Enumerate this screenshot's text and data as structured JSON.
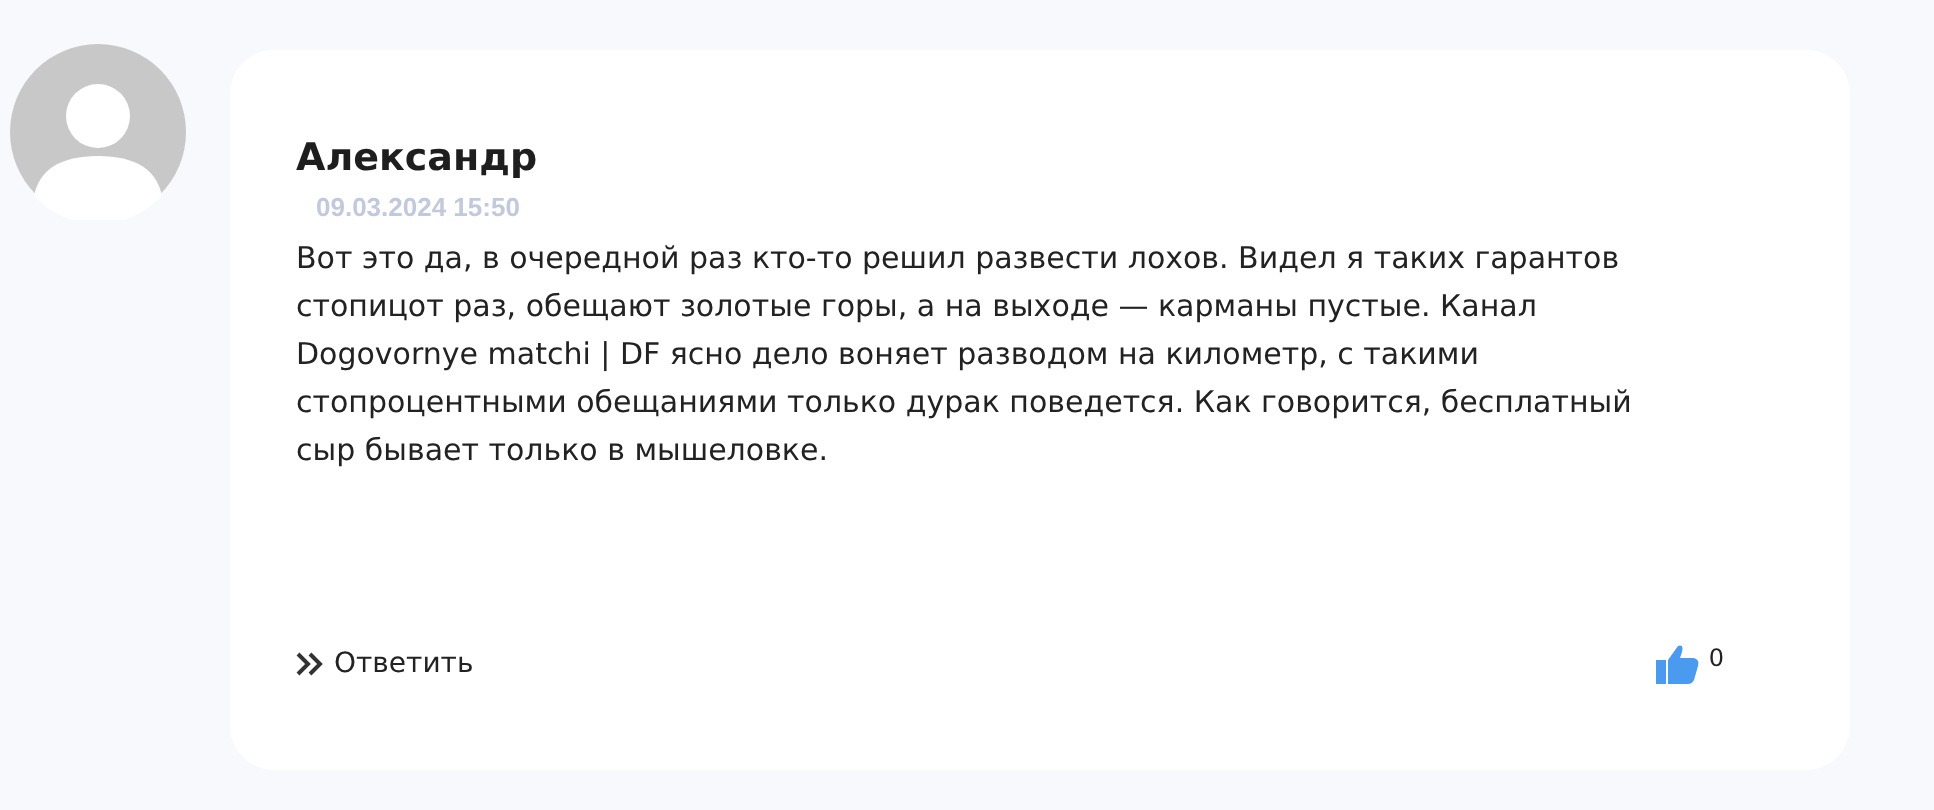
{
  "comment": {
    "author": "Александр",
    "date": "09.03.2024 15:50",
    "text": "Вот это да, в очередной раз кто-то решил развести лохов. Видел я таких гарантов стопицот раз, обещают золотые горы, а на выходе — карманы пустые. Канал Dogovornye matchi | DF ясно дело воняет разводом на километр, с такими стопроцентными обещаниями только дурак поведется. Как говорится, бесплатный сыр бывает только в мышеловке.",
    "reply": "Ответить",
    "likes": "0"
  }
}
